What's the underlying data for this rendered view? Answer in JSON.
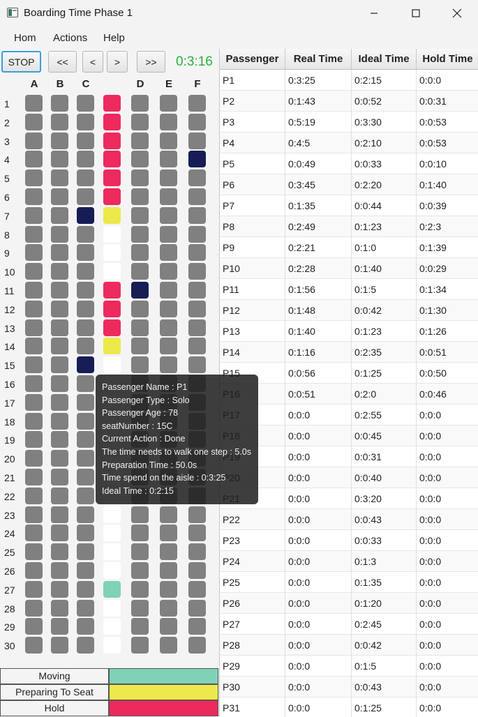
{
  "window": {
    "title": "Boarding Time Phase 1"
  },
  "menu": [
    "Hom",
    "Actions",
    "Help"
  ],
  "controls": {
    "stop": "STOP",
    "first": "<<",
    "prev": "<",
    "next": ">",
    "last": ">>",
    "timer": "0:3:16"
  },
  "columns": [
    "A",
    "B",
    "C",
    "D",
    "E",
    "F"
  ],
  "rows": 30,
  "colors": {
    "seat": "#808080",
    "empty_aisle": "#ffffff",
    "seated": "#161d55",
    "hold": "#ec2a5e",
    "preparing": "#ede84b",
    "moving": "#7fd2b8"
  },
  "seated": [
    {
      "row": 4,
      "seat": "F"
    },
    {
      "row": 7,
      "seat": "C"
    },
    {
      "row": 11,
      "seat": "D"
    },
    {
      "row": 15,
      "seat": "C"
    }
  ],
  "aisle_states": {
    "1": "hold",
    "2": "hold",
    "3": "hold",
    "4": "hold",
    "5": "hold",
    "6": "hold",
    "7": "preparing",
    "11": "hold",
    "12": "hold",
    "13": "hold",
    "14": "preparing",
    "27": "moving"
  },
  "legend": [
    {
      "label": "Moving",
      "color": "#7fd2b8"
    },
    {
      "label": "Preparing To Seat",
      "color": "#ede84b"
    },
    {
      "label": "Hold",
      "color": "#ec2a5e"
    }
  ],
  "table": {
    "headers": [
      "Passenger",
      "Real Time",
      "Ideal Time",
      "Hold Time"
    ],
    "rows": [
      [
        "P1",
        "0:3:25",
        "0:2:15",
        "0:0:0"
      ],
      [
        "P2",
        "0:1:43",
        "0:0:52",
        "0:0:31"
      ],
      [
        "P3",
        "0:5:19",
        "0:3:30",
        "0:0:53"
      ],
      [
        "P4",
        "0:4:5",
        "0:2:10",
        "0:0:53"
      ],
      [
        "P5",
        "0:0:49",
        "0:0:33",
        "0:0:10"
      ],
      [
        "P6",
        "0:3:45",
        "0:2:20",
        "0:1:40"
      ],
      [
        "P7",
        "0:1:35",
        "0:0:44",
        "0:0:39"
      ],
      [
        "P8",
        "0:2:49",
        "0:1:23",
        "0:2:3"
      ],
      [
        "P9",
        "0:2:21",
        "0:1:0",
        "0:1:39"
      ],
      [
        "P10",
        "0:2:28",
        "0:1:40",
        "0:0:29"
      ],
      [
        "P11",
        "0:1:56",
        "0:1:5",
        "0:1:34"
      ],
      [
        "P12",
        "0:1:48",
        "0:0:42",
        "0:1:30"
      ],
      [
        "P13",
        "0:1:40",
        "0:1:23",
        "0:1:26"
      ],
      [
        "P14",
        "0:1:16",
        "0:2:35",
        "0:0:51"
      ],
      [
        "P15",
        "0:0:56",
        "0:1:25",
        "0:0:50"
      ],
      [
        "P16",
        "0:0:51",
        "0:2:0",
        "0:0:46"
      ],
      [
        "P17",
        "0:0:0",
        "0:2:55",
        "0:0:0"
      ],
      [
        "P18",
        "0:0:0",
        "0:0:45",
        "0:0:0"
      ],
      [
        "P19",
        "0:0:0",
        "0:0:31",
        "0:0:0"
      ],
      [
        "P20",
        "0:0:0",
        "0:0:40",
        "0:0:0"
      ],
      [
        "P21",
        "0:0:0",
        "0:3:20",
        "0:0:0"
      ],
      [
        "P22",
        "0:0:0",
        "0:0:43",
        "0:0:0"
      ],
      [
        "P23",
        "0:0:0",
        "0:0:33",
        "0:0:0"
      ],
      [
        "P24",
        "0:0:0",
        "0:1:3",
        "0:0:0"
      ],
      [
        "P25",
        "0:0:0",
        "0:1:35",
        "0:0:0"
      ],
      [
        "P26",
        "0:0:0",
        "0:1:20",
        "0:0:0"
      ],
      [
        "P27",
        "0:0:0",
        "0:2:45",
        "0:0:0"
      ],
      [
        "P28",
        "0:0:0",
        "0:0:42",
        "0:0:0"
      ],
      [
        "P29",
        "0:0:0",
        "0:1:5",
        "0:0:0"
      ],
      [
        "P30",
        "0:0:0",
        "0:0:43",
        "0:0:0"
      ],
      [
        "P31",
        "0:0:0",
        "0:1:25",
        "0:0:0"
      ]
    ]
  },
  "tooltip": {
    "lines": [
      "Passenger Name : P1",
      "Passenger Type : Solo",
      "Passenger Age : 78",
      "seatNumber : 15C",
      "Current Action : Done",
      "The time needs to walk one step : 5.0s",
      "Preparation Time : 50.0s",
      "Time spend on the aisle : 0:3:25",
      "Ideal Time : 0:2:15"
    ]
  }
}
